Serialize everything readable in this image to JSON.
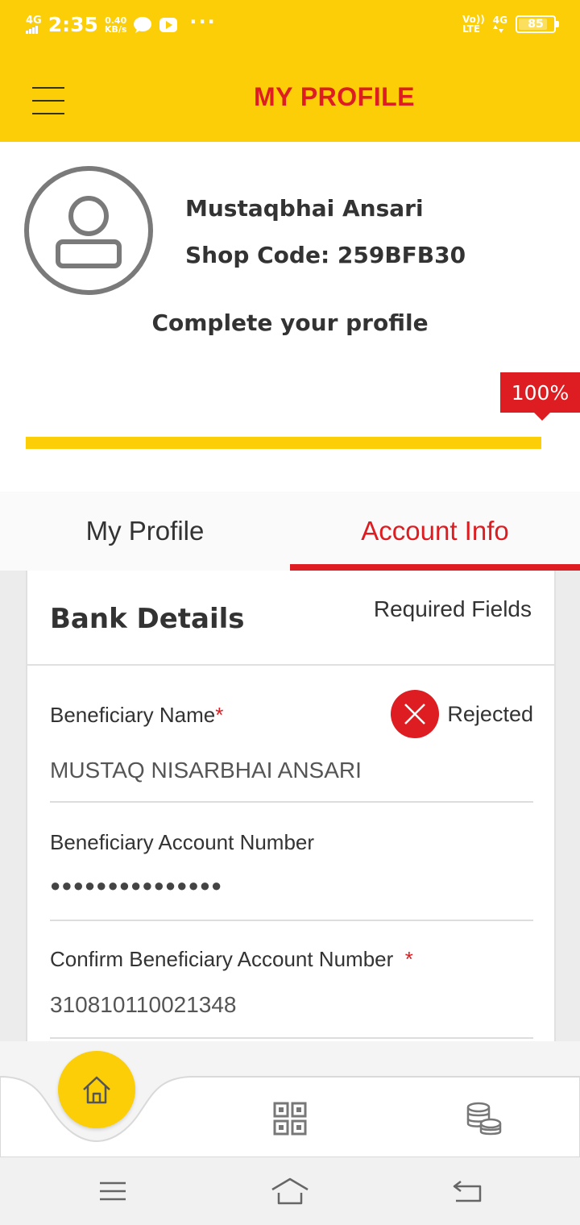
{
  "status_bar": {
    "network": "4G",
    "time": "2:35",
    "speed_value": "0.40",
    "speed_unit": "KB/s",
    "more": "···",
    "volte_top": "Vo))",
    "volte_bottom": "LTE",
    "network_right": "4G",
    "battery": "85",
    "battery_level": 0.85
  },
  "header": {
    "title": "MY PROFILE"
  },
  "profile": {
    "name": "Mustaqbhai Ansari",
    "shop_code": "Shop Code: 259BFB30",
    "complete_label": "Complete your profile",
    "progress_label": "100%",
    "progress_value": 1.0
  },
  "tabs": [
    {
      "label": "My Profile",
      "active": false
    },
    {
      "label": "Account Info",
      "active": true
    }
  ],
  "bank_details": {
    "title": "Bank Details",
    "required_label": "Required Fields",
    "fields": [
      {
        "label": "Beneficiary Name",
        "required": "*",
        "value": "MUSTAQ NISARBHAI ANSARI",
        "status": "Rejected"
      },
      {
        "label": "Beneficiary Account Number",
        "value": "●●●●●●●●●●●●●●●"
      },
      {
        "label": "Confirm Beneficiary Account Number",
        "required": "*",
        "value": "310810110021348"
      }
    ]
  },
  "bottom_nav": {
    "items": [
      "home-icon",
      "qr-code-icon",
      "coins-icon"
    ]
  },
  "system_nav": {
    "items": [
      "menu-icon",
      "home-icon",
      "back-icon"
    ]
  },
  "colors": {
    "brand_yellow": "#FBCE07",
    "brand_red": "#DD1D21"
  }
}
